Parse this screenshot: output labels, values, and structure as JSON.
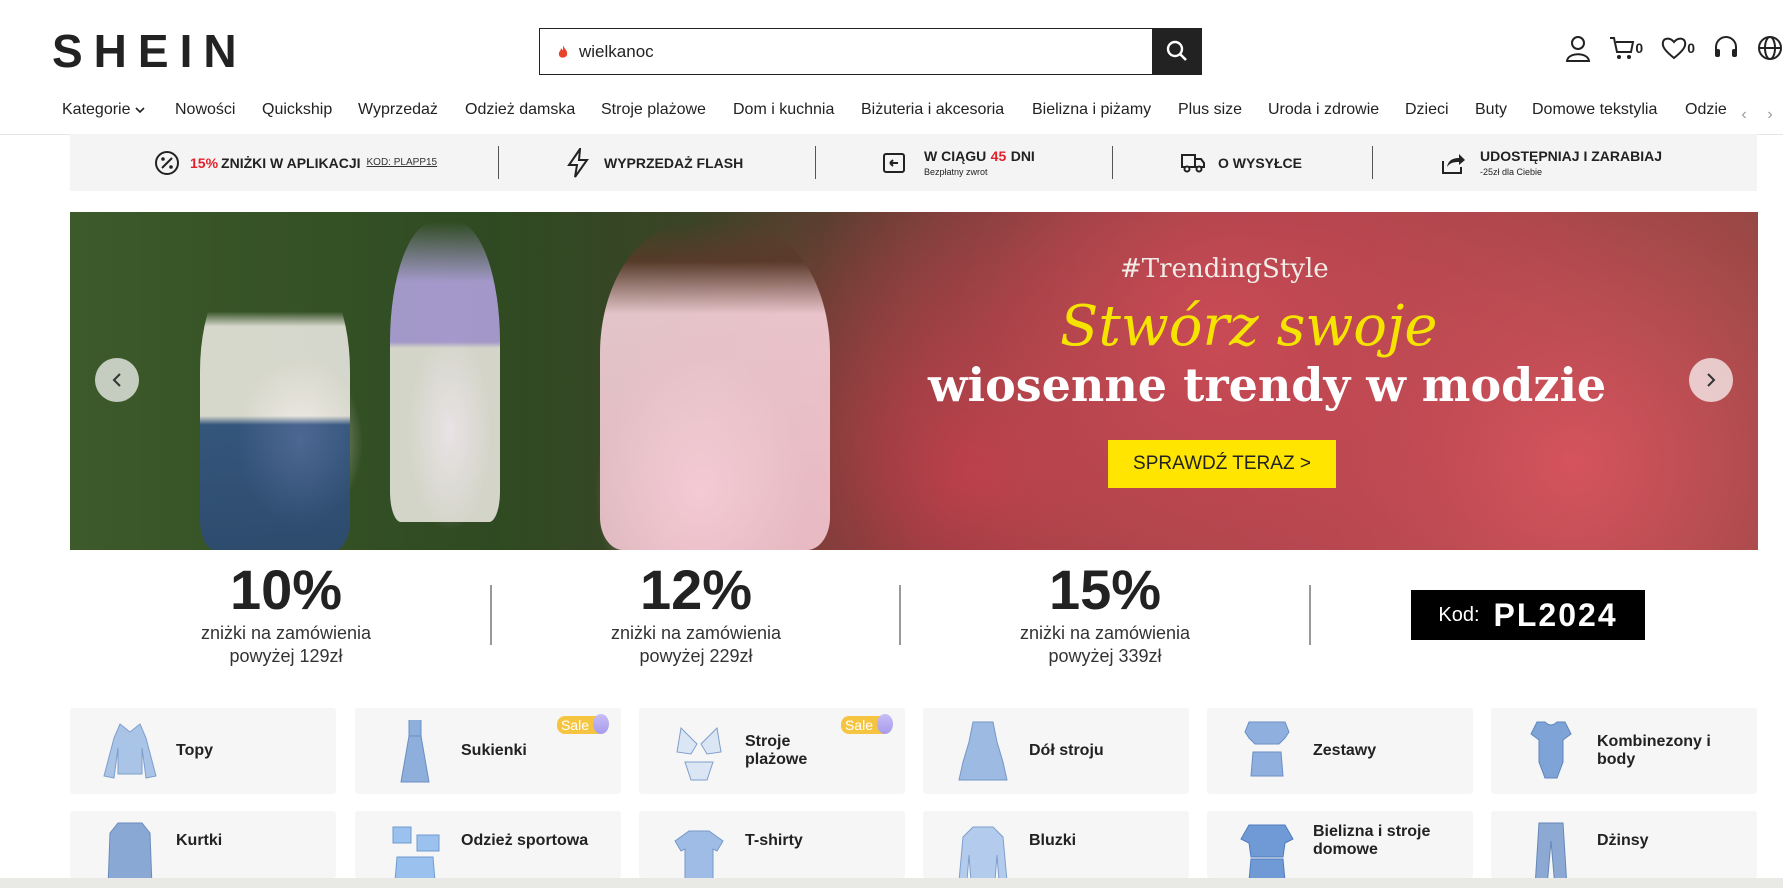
{
  "header": {
    "logo": "SHEIN",
    "search_value": "wielkanoc",
    "cart_count": "0",
    "wishlist_count": "0"
  },
  "nav": {
    "items": [
      "Kategorie",
      "Nowości",
      "Quickship",
      "Wyprzedaż",
      "Odzież damska",
      "Stroje plażowe",
      "Dom i kuchnia",
      "Biżuteria i akcesoria",
      "Bielizna i piżamy",
      "Plus size",
      "Uroda i zdrowie",
      "Dzieci",
      "Buty",
      "Domowe tekstylia",
      "Odzie"
    ]
  },
  "strip": {
    "app_discount_pct": "15%",
    "app_discount_text": "ZNIŻKI W APLIKACJI",
    "app_code": "KOD: PLAPP15",
    "flash": "WYPRZEDAŻ FLASH",
    "return_pre": "W CIĄGU",
    "return_days": "45",
    "return_post": "DNI",
    "return_sub": "Bezpłatny zwrot",
    "shipping": "O WYSYŁCE",
    "share": "UDOSTĘPNIAJ I ZARABIAJ",
    "share_sub": "-25zł dla Ciebie"
  },
  "banner": {
    "tag": "#TrendingStyle",
    "script": "Stwórz swoje",
    "headline": "wiosenne trendy w modzie",
    "cta": "SPRAWDŹ TERAZ >"
  },
  "promos": [
    {
      "pct": "10%",
      "line1": "zniżki na zamówienia",
      "line2": "powyżej 129zł"
    },
    {
      "pct": "12%",
      "line1": "zniżki na zamówienia",
      "line2": "powyżej 229zł"
    },
    {
      "pct": "15%",
      "line1": "zniżki na zamówienia",
      "line2": "powyżej 339zł"
    }
  ],
  "code": {
    "label": "Kod:",
    "value": "PL2024"
  },
  "categories": {
    "sale_badge": "Sale",
    "row1": [
      "Topy",
      "Sukienki",
      "Stroje plażowe",
      "Dół stroju",
      "Zestawy",
      "Kombinezony i body"
    ],
    "row2": [
      "Kurtki",
      "Odzież sportowa",
      "T-shirty",
      "Bluzki",
      "Bielizna i stroje domowe",
      "Dżinsy"
    ]
  },
  "colors": {
    "accent": "#e4202b",
    "cta": "#ffe500",
    "product_blue": "#9cb9e0"
  }
}
